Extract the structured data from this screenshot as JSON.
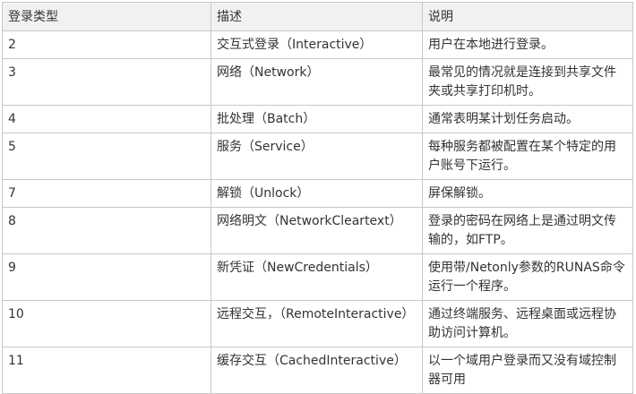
{
  "table": {
    "headers": [
      "登录类型",
      "描述",
      "说明"
    ],
    "rows": [
      [
        "2",
        "交互式登录（Interactive）",
        "用户在本地进行登录。"
      ],
      [
        "3",
        "网络（Network）",
        "最常见的情况就是连接到共享文件夹或共享打印机时。"
      ],
      [
        "4",
        "批处理（Batch）",
        "通常表明某计划任务启动。"
      ],
      [
        "5",
        "服务（Service）",
        "每种服务都被配置在某个特定的用户账号下运行。"
      ],
      [
        "7",
        "解锁（Unlock）",
        "屏保解锁。"
      ],
      [
        "8",
        "网络明文（NetworkCleartext）",
        "登录的密码在网络上是通过明文传输的，如FTP。"
      ],
      [
        "9",
        "新凭证（NewCredentials）",
        "使用带/Netonly参数的RUNAS命令运行一个程序。"
      ],
      [
        "10",
        "远程交互，（RemoteInteractive）",
        "通过终端服务、远程桌面或远程协助访问计算机。"
      ],
      [
        "11",
        "缓存交互（CachedInteractive）",
        "以一个域用户登录而又没有域控制器可用"
      ]
    ]
  }
}
